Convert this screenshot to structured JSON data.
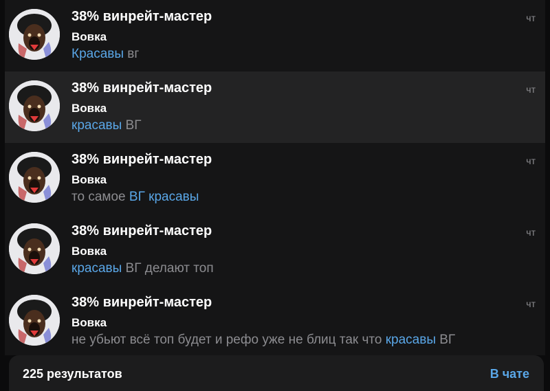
{
  "results": [
    {
      "title": "38% винрейт-мастер",
      "sender": "Вовка",
      "time": "чт",
      "snippet": [
        {
          "t": "Красавы",
          "hl": true
        },
        {
          "t": " вг",
          "hl": false
        }
      ]
    },
    {
      "title": "38% винрейт-мастер",
      "sender": "Вовка",
      "time": "чт",
      "snippet": [
        {
          "t": "красавы",
          "hl": true
        },
        {
          "t": " ВГ",
          "hl": false
        }
      ]
    },
    {
      "title": "38% винрейт-мастер",
      "sender": "Вовка",
      "time": "чт",
      "snippet": [
        {
          "t": "то самое ",
          "hl": false
        },
        {
          "t": "ВГ красавы",
          "hl": true
        }
      ]
    },
    {
      "title": "38% винрейт-мастер",
      "sender": "Вовка",
      "time": "чт",
      "snippet": [
        {
          "t": "красавы",
          "hl": true
        },
        {
          "t": " ВГ делают топ",
          "hl": false
        }
      ]
    },
    {
      "title": "38% винрейт-мастер",
      "sender": "Вовка",
      "time": "чт",
      "snippet": [
        {
          "t": "не убьют всё топ будет и рефо уже не блиц так что ",
          "hl": false
        },
        {
          "t": "красавы",
          "hl": true
        },
        {
          "t": " ВГ",
          "hl": false
        }
      ]
    }
  ],
  "footer": {
    "count_label": "225 результатов",
    "in_chat_label": "В чате"
  },
  "colors": {
    "accent": "#5aa7e8",
    "muted": "#8c8c90",
    "selected_row": "#232324"
  },
  "avatar_icon": "dog-avatar-icon"
}
